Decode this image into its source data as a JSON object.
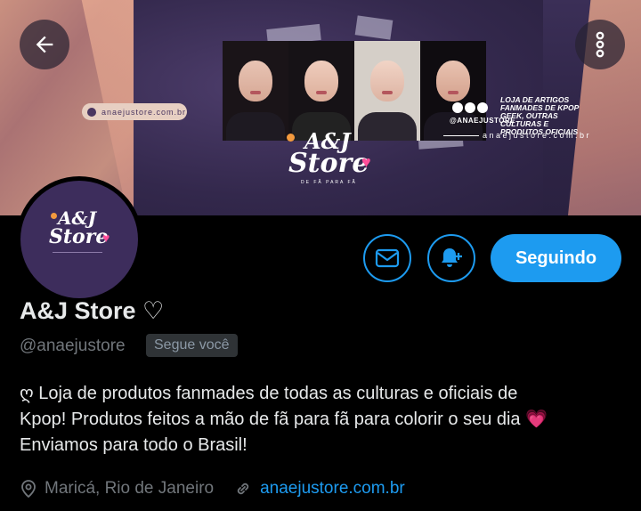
{
  "banner": {
    "site_pill": "anaejustore.com.br",
    "logo_line1": "A&J",
    "logo_line2": "Store",
    "logo_tagline": "DE FÃ PARA FÃ",
    "social_handle": "@ANAEJUSTORE",
    "social_desc": "LOJA DE ARTIGOS FANMADES DE KPOP GEEK, OUTRAS CULTURAS E PRODUTOS OFICIAIS",
    "social_url": "anaejustore.com.br"
  },
  "avatar": {
    "line1": "A&J",
    "line2": "Store"
  },
  "actions": {
    "follow_label": "Seguindo"
  },
  "profile": {
    "name": "A&J Store ♡",
    "handle": "@anaejustore",
    "follows_you": "Segue você",
    "bio_line1": "ღ Loja de produtos fanmades de todas as culturas e oficiais de",
    "bio_line2": "Kpop! Produtos feitos a mão de fã para fã para colorir o seu dia",
    "bio_heart": "💗",
    "bio_line3": "Enviamos para todo o Brasil!",
    "location": "Maricá, Rio de Janeiro",
    "website": "anaejustore.com.br"
  },
  "colors": {
    "accent": "#1d9bf0",
    "background": "#000000",
    "banner_purple": "#3b2f57",
    "muted_text": "#71767b"
  },
  "icons": [
    "back-arrow-icon",
    "more-vertical-icon",
    "mail-icon",
    "bell-plus-icon",
    "location-pin-icon",
    "link-icon"
  ]
}
